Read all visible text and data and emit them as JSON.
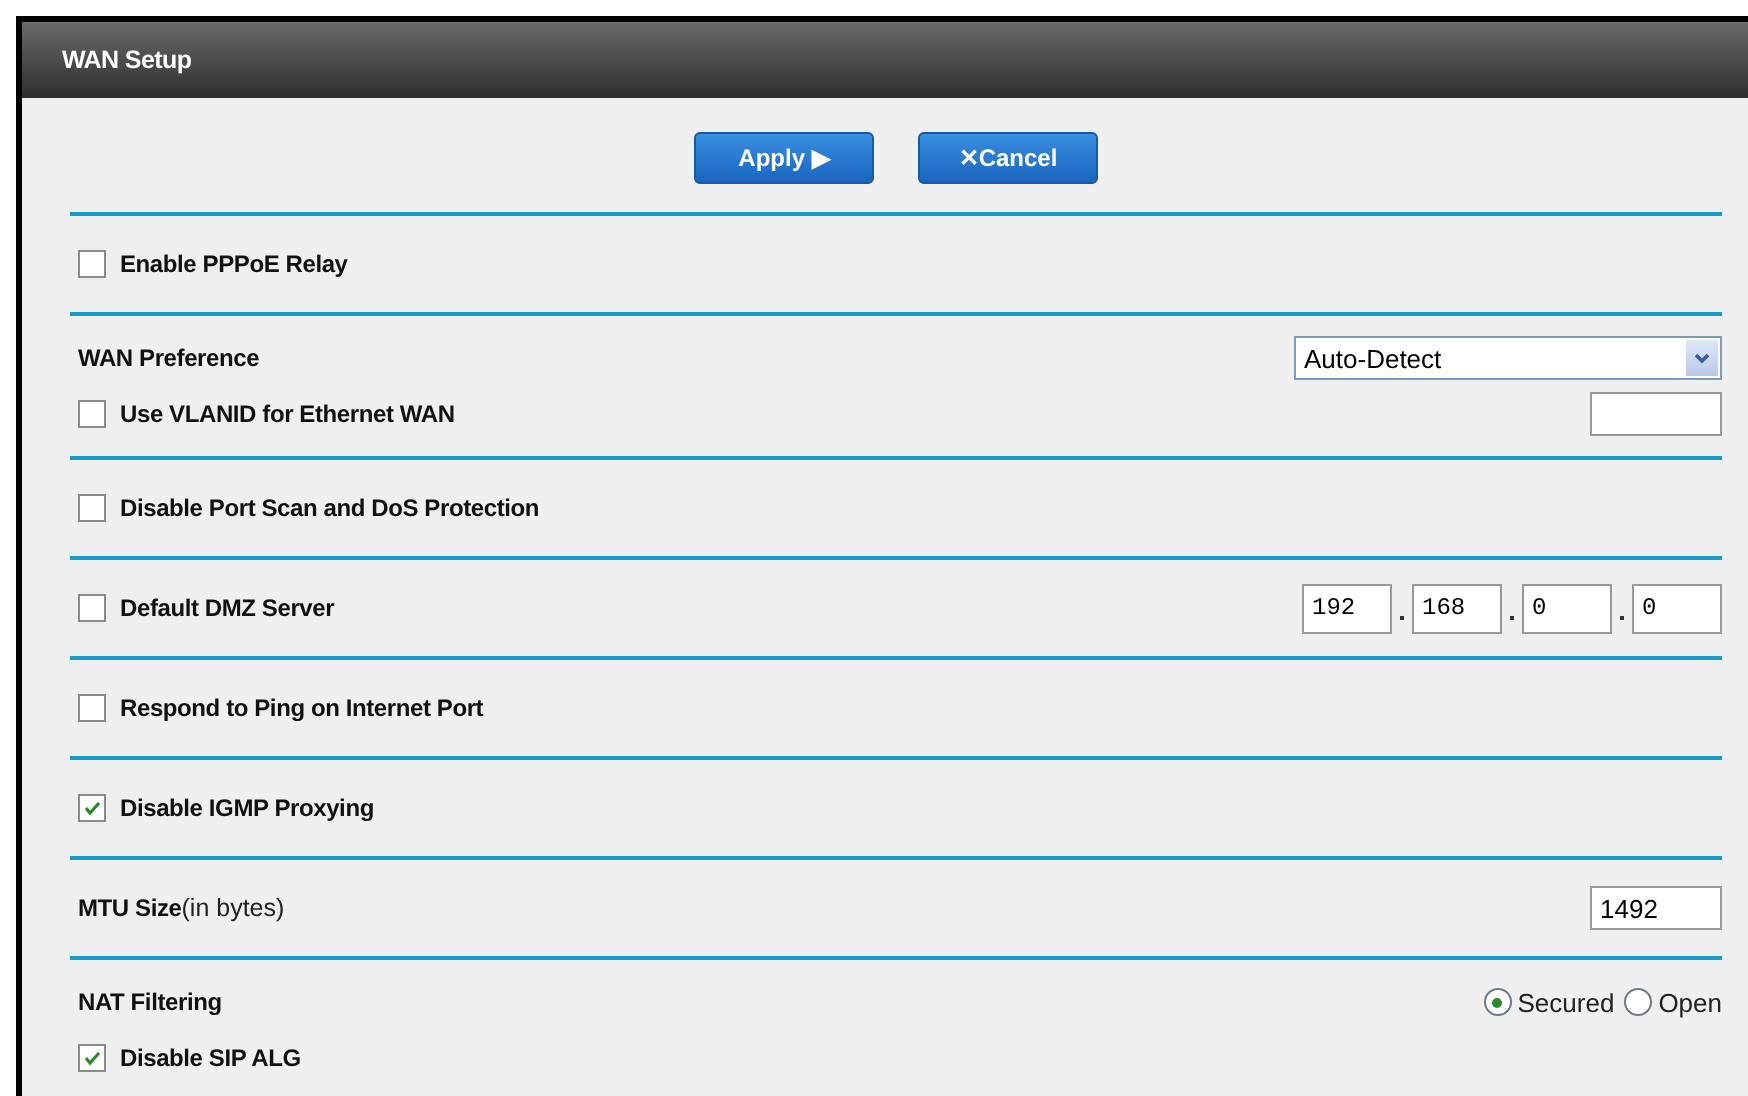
{
  "window": {
    "title": "WAN Setup"
  },
  "buttons": [
    "Apply ▶",
    "✕Cancel"
  ],
  "sections": [
    {
      "rows": [
        {
          "kind": "checkbox",
          "label": "Enable PPPoE Relay",
          "checked": false
        }
      ]
    },
    {
      "rows": [
        {
          "kind": "label",
          "label": "WAN Preference",
          "control": {
            "kind": "select",
            "value": "Auto-Detect"
          }
        },
        {
          "kind": "checkbox",
          "label": "Use VLANID for Ethernet WAN",
          "checked": false,
          "control": {
            "kind": "text"
          }
        }
      ]
    },
    {
      "rows": [
        {
          "kind": "checkbox",
          "label": "Disable Port Scan and DoS Protection",
          "checked": false
        }
      ]
    },
    {
      "rows": [
        {
          "kind": "checkbox",
          "label": "Default DMZ Server",
          "checked": false,
          "control": {
            "kind": "ip",
            "octets": [
              "192",
              "168",
              "0",
              "0"
            ]
          }
        }
      ]
    },
    {
      "rows": [
        {
          "kind": "checkbox",
          "label": "Respond to Ping on Internet Port",
          "checked": false
        }
      ]
    },
    {
      "rows": [
        {
          "kind": "checkbox",
          "label": "Disable IGMP Proxying",
          "checked": true
        }
      ]
    },
    {
      "rows": [
        {
          "kind": "label",
          "label": "MTU Size",
          "note": "(in bytes)",
          "control": {
            "kind": "text",
            "value": "1492"
          }
        }
      ]
    },
    {
      "rows": [
        {
          "kind": "label",
          "label": "NAT Filtering",
          "control": {
            "kind": "radio",
            "options": [
              {
                "label": "Secured",
                "selected": true
              },
              {
                "label": "Open",
                "selected": false
              }
            ]
          }
        },
        {
          "kind": "checkbox",
          "label": "Disable SIP ALG",
          "checked": true
        }
      ]
    }
  ]
}
